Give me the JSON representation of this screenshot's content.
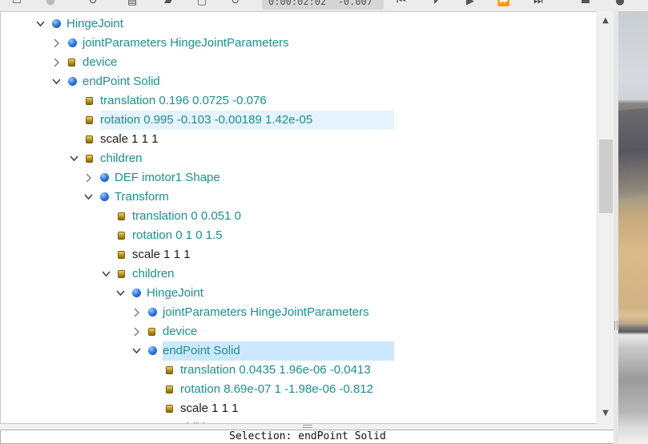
{
  "toolbar": {
    "sim_time": "0:00:02:02  -0.007",
    "icons": [
      "panel-toggle-icon",
      "disabled-button-icon",
      "reload-icon",
      "save-icon",
      "export-icon",
      "reset-icon",
      "rewind-icon",
      "step-icon",
      "play-icon",
      "fast-forward-icon",
      "record-icon",
      "screenshot-icon"
    ]
  },
  "tree": {
    "rows": [
      {
        "name": "node-hingejoint",
        "label": "HingeJoint",
        "icon": "ball",
        "color": "teal",
        "arrow": "expanded"
      },
      {
        "name": "node-jointparameters",
        "label": "jointParameters HingeJointParameters",
        "icon": "ball",
        "color": "teal",
        "arrow": "collapsed"
      },
      {
        "name": "field-device",
        "label": "device",
        "icon": "can",
        "color": "teal",
        "arrow": "collapsed"
      },
      {
        "name": "node-endpoint-solid",
        "label": "endPoint Solid",
        "icon": "ball",
        "color": "teal",
        "arrow": "expanded"
      },
      {
        "name": "field-translation",
        "label": "translation 0.196 0.0725 -0.076",
        "icon": "can",
        "color": "teal",
        "arrow": ""
      },
      {
        "name": "field-rotation",
        "label": "rotation 0.995 -0.103 -0.00189 1.42e-05",
        "icon": "can",
        "color": "teal",
        "arrow": "",
        "state": "hover"
      },
      {
        "name": "field-scale",
        "label": "scale 1 1 1",
        "icon": "can",
        "color": "black",
        "arrow": ""
      },
      {
        "name": "field-children",
        "label": "children",
        "icon": "can",
        "color": "teal",
        "arrow": "expanded"
      },
      {
        "name": "node-def-imotor1-shape",
        "label": "DEF imotor1 Shape",
        "icon": "ball",
        "color": "teal",
        "arrow": "collapsed"
      },
      {
        "name": "node-transform",
        "label": "Transform",
        "icon": "ball",
        "color": "teal",
        "arrow": "expanded"
      },
      {
        "name": "field-transform-translation",
        "label": "translation 0 0.051 0",
        "icon": "can",
        "color": "teal",
        "arrow": ""
      },
      {
        "name": "field-transform-rotation",
        "label": "rotation 0 1 0 1.5",
        "icon": "can",
        "color": "teal",
        "arrow": ""
      },
      {
        "name": "field-transform-scale",
        "label": "scale 1 1 1",
        "icon": "can",
        "color": "black",
        "arrow": ""
      },
      {
        "name": "field-transform-children",
        "label": "children",
        "icon": "can",
        "color": "teal",
        "arrow": "expanded"
      },
      {
        "name": "node-hingejoint-inner",
        "label": "HingeJoint",
        "icon": "ball",
        "color": "teal",
        "arrow": "expanded"
      },
      {
        "name": "node-jointparameters-inner",
        "label": "jointParameters HingeJointParameters",
        "icon": "ball",
        "color": "teal",
        "arrow": "collapsed"
      },
      {
        "name": "field-device-inner",
        "label": "device",
        "icon": "can",
        "color": "teal",
        "arrow": "collapsed"
      },
      {
        "name": "node-endpoint-solid-inner",
        "label": "endPoint Solid",
        "icon": "ball",
        "color": "teal",
        "arrow": "expanded",
        "state": "selected"
      },
      {
        "name": "field-translation-inner",
        "label": "translation 0.0435 1.96e-06 -0.0413",
        "icon": "can",
        "color": "teal",
        "arrow": ""
      },
      {
        "name": "field-rotation-inner",
        "label": "rotation 8.69e-07 1 -1.98e-06 -0.812",
        "icon": "can",
        "color": "teal",
        "arrow": ""
      },
      {
        "name": "field-scale-inner",
        "label": "scale 1 1 1",
        "icon": "can",
        "color": "black",
        "arrow": ""
      },
      {
        "name": "field-children-inner",
        "label": "children",
        "icon": "can",
        "color": "teal",
        "arrow": ""
      }
    ]
  },
  "status": {
    "text": "Selection: endPoint Solid"
  },
  "colors": {
    "teal_text": "#1a8f8f",
    "selected_bg": "#cce8ff",
    "hover_bg": "#e5f3ff"
  }
}
